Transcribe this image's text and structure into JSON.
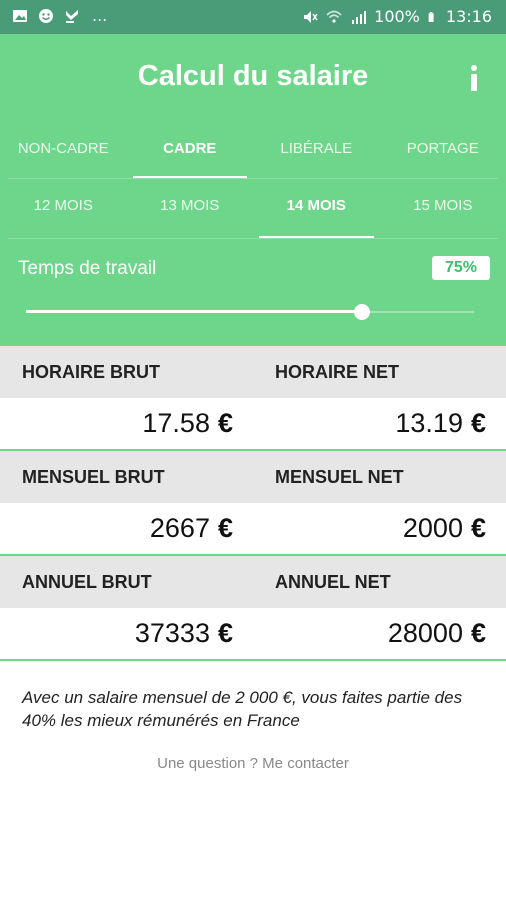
{
  "status_bar": {
    "battery": "100%",
    "time": "13:16",
    "overflow": "..."
  },
  "app": {
    "title": "Calcul du salaire"
  },
  "status_tabs": [
    {
      "label": "NON-CADRE",
      "active": false
    },
    {
      "label": "CADRE",
      "active": true
    },
    {
      "label": "LIBÉRALE",
      "active": false
    },
    {
      "label": "PORTAGE",
      "active": false
    }
  ],
  "month_tabs": [
    {
      "label": "12 MOIS",
      "active": false
    },
    {
      "label": "13 MOIS",
      "active": false
    },
    {
      "label": "14 MOIS",
      "active": true
    },
    {
      "label": "15 MOIS",
      "active": false
    }
  ],
  "worktime": {
    "label": "Temps de travail",
    "percent_label": "75%",
    "slider_fraction": 0.75
  },
  "results": {
    "horaire": {
      "brut_label": "HORAIRE BRUT",
      "net_label": "HORAIRE NET",
      "brut_value": "17.58",
      "net_value": "13.19"
    },
    "mensuel": {
      "brut_label": "MENSUEL BRUT",
      "net_label": "MENSUEL NET",
      "brut_value": "2667",
      "net_value": "2000"
    },
    "annuel": {
      "brut_label": "ANNUEL BRUT",
      "net_label": "ANNUEL NET",
      "brut_value": "37333",
      "net_value": "28000"
    },
    "currency": "€"
  },
  "note": "Avec un salaire mensuel de 2 000 €, vous faites partie des 40% les mieux rémunérés en France",
  "contact": "Une question ? Me contacter",
  "colors": {
    "header": "#6ed68a",
    "statusbar": "#4a9b78",
    "accent": "#3fbf6f"
  },
  "icons": [
    "image-icon",
    "smiley-icon",
    "check-icon",
    "mute-icon",
    "wifi-icon",
    "signal-icon",
    "battery-icon",
    "info-icon"
  ]
}
